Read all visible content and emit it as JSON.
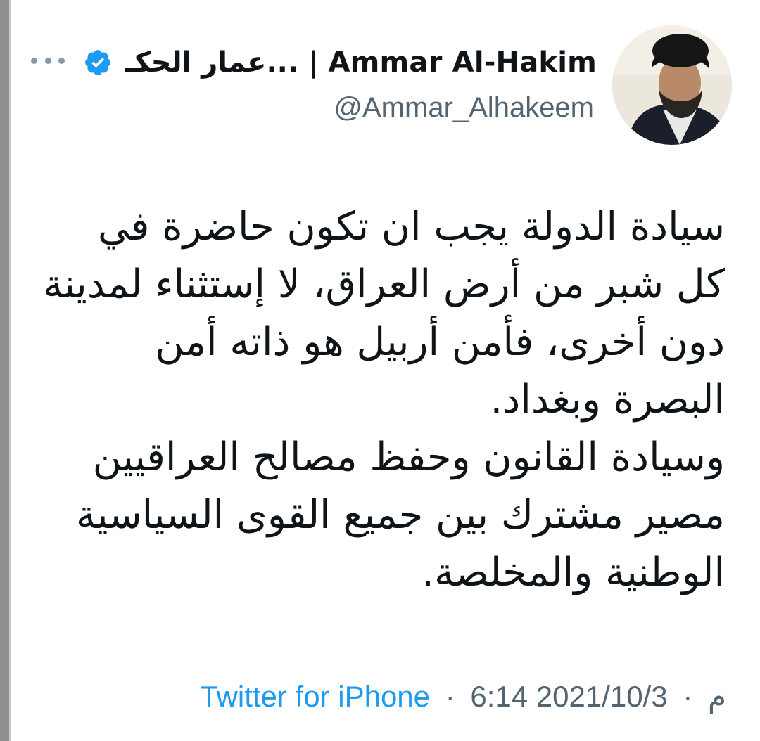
{
  "author": {
    "display_name": "عمار الحكـ... | Ammar Al-Hakim",
    "handle": "@Ammar_Alhakeem",
    "verified": true
  },
  "icons": {
    "more": "more-horizontal-icon",
    "verified": "verified-badge-icon"
  },
  "colors": {
    "verified_blue": "#1d9bf0",
    "source_link": "#1d9bf0",
    "secondary_text": "#536471",
    "primary_text": "#0f1419"
  },
  "tweet": {
    "lines": [
      "سيادة الدولة يجب ان تكون حاضرة في",
      "كل شبر من أرض العراق، لا إستثناء لمدينة",
      "دون أخرى، فأمن أربيل هو ذاته أمن",
      "البصرة وبغداد.",
      " وسيادة القانون وحفظ مصالح العراقيين",
      "مصير مشترك بين جميع القوى السياسية",
      "الوطنية والمخلصة."
    ]
  },
  "meta": {
    "time": "6:14 م",
    "date": "2021/10/3",
    "separator": "·",
    "source": "Twitter for iPhone"
  }
}
